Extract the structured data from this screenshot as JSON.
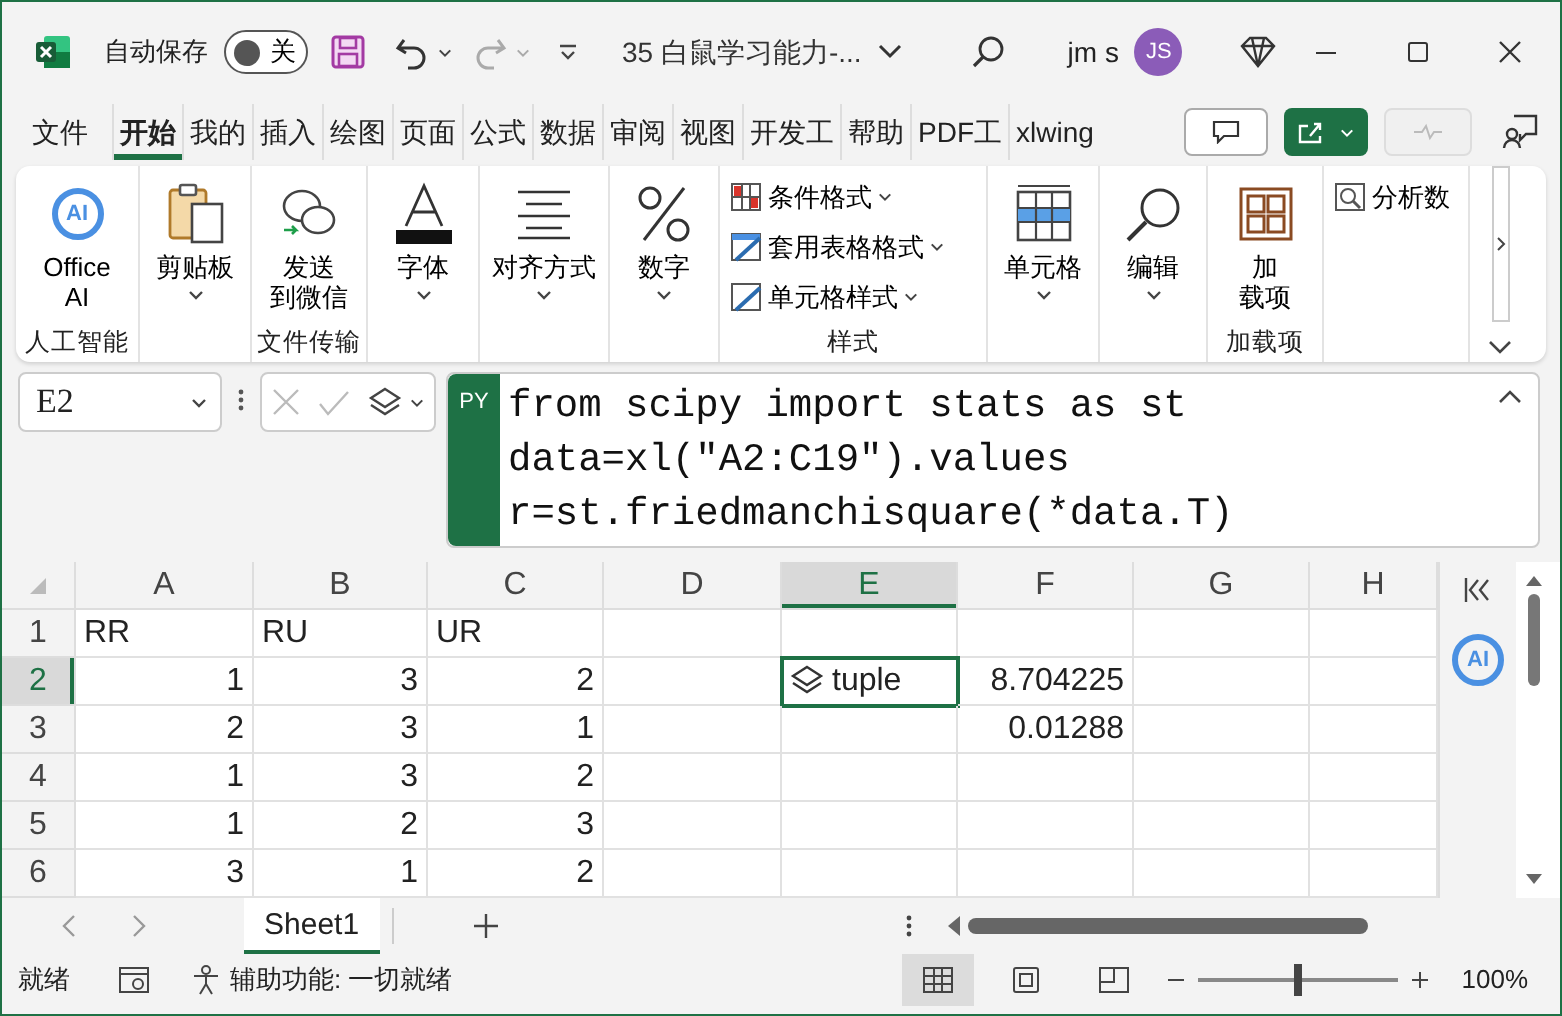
{
  "title_bar": {
    "autosave": {
      "label": "自动保存",
      "state_text": "关",
      "on": false
    },
    "filename": "35 白鼠学习能力-...",
    "user": "jm s",
    "avatar": "JS"
  },
  "tabs": [
    {
      "label": "文件",
      "selected": false
    },
    {
      "label": "开始",
      "selected": true
    },
    {
      "label": "我的",
      "selected": false
    },
    {
      "label": "插入",
      "selected": false
    },
    {
      "label": "绘图",
      "selected": false
    },
    {
      "label": "页面",
      "selected": false
    },
    {
      "label": "公式",
      "selected": false
    },
    {
      "label": "数据",
      "selected": false
    },
    {
      "label": "审阅",
      "selected": false
    },
    {
      "label": "视图",
      "selected": false
    },
    {
      "label": "开发工",
      "selected": false
    },
    {
      "label": "帮助",
      "selected": false
    },
    {
      "label": "PDF工",
      "selected": false
    },
    {
      "label": "xlwing",
      "selected": false
    }
  ],
  "ribbon": {
    "groups": [
      {
        "label": "人工智能",
        "items": [
          {
            "lines": [
              "Office",
              "AI"
            ],
            "kind": "large",
            "dropdown": false,
            "logo_text": "AI"
          }
        ]
      },
      {
        "items": [
          {
            "lines": [
              "剪贴板"
            ],
            "kind": "large",
            "dropdown": true
          }
        ]
      },
      {
        "label": "文件传输",
        "items": [
          {
            "lines": [
              "发送",
              "到微信"
            ],
            "kind": "large",
            "dropdown": false
          }
        ]
      },
      {
        "items": [
          {
            "lines": [
              "字体"
            ],
            "kind": "large",
            "dropdown": true
          }
        ]
      },
      {
        "items": [
          {
            "lines": [
              "对齐方式"
            ],
            "kind": "large",
            "dropdown": true
          }
        ]
      },
      {
        "items": [
          {
            "lines": [
              "数字"
            ],
            "kind": "large",
            "dropdown": true
          }
        ]
      },
      {
        "label": "样式",
        "items": [
          {
            "lines": [
              "条件格式"
            ],
            "kind": "small",
            "dropdown": true
          },
          {
            "lines": [
              "套用表格格式"
            ],
            "kind": "small",
            "dropdown": true
          },
          {
            "lines": [
              "单元格样式"
            ],
            "kind": "small",
            "dropdown": true
          }
        ]
      },
      {
        "items": [
          {
            "lines": [
              "单元格"
            ],
            "kind": "large",
            "dropdown": true
          }
        ]
      },
      {
        "items": [
          {
            "lines": [
              "编辑"
            ],
            "kind": "large",
            "dropdown": true
          }
        ]
      },
      {
        "label": "加载项",
        "items": [
          {
            "lines": [
              "加",
              "载项"
            ],
            "kind": "large",
            "dropdown": false
          }
        ]
      },
      {
        "items": [
          {
            "lines": [
              "分析数"
            ],
            "kind": "small",
            "dropdown": false
          }
        ]
      }
    ]
  },
  "formula_bar": {
    "name_box": "E2",
    "badge": "PY",
    "lines": [
      "from scipy import stats as st",
      "data=xl(\"A2:C19\").values",
      "r=st.friedmanchisquare(*data.T)"
    ]
  },
  "sheet": {
    "columns": [
      "A",
      "B",
      "C",
      "D",
      "E",
      "F",
      "G",
      "H"
    ],
    "rows": [
      {
        "number": "1",
        "cells": [
          {
            "text": "RR",
            "kind": "text",
            "selected": false
          },
          {
            "text": "RU",
            "kind": "text",
            "selected": false
          },
          {
            "text": "UR",
            "kind": "text",
            "selected": false
          }
        ]
      },
      {
        "number": "2",
        "cells": [
          {
            "text": "1",
            "kind": "number",
            "selected": false
          },
          {
            "text": "3",
            "kind": "number",
            "selected": false
          },
          {
            "text": "2",
            "kind": "number",
            "selected": false
          },
          {
            "text": "",
            "kind": "text",
            "selected": false
          },
          {
            "text": "tuple",
            "kind": "py_object",
            "selected": true
          },
          {
            "text": "8.704225",
            "kind": "number",
            "selected": false
          }
        ]
      },
      {
        "number": "3",
        "cells": [
          {
            "text": "2",
            "kind": "number",
            "selected": false
          },
          {
            "text": "3",
            "kind": "number",
            "selected": false
          },
          {
            "text": "1",
            "kind": "number",
            "selected": false
          },
          {
            "text": "",
            "kind": "text",
            "selected": false
          },
          {
            "text": "",
            "kind": "text",
            "selected": false
          },
          {
            "text": "0.01288",
            "kind": "number",
            "selected": false
          }
        ]
      },
      {
        "number": "4",
        "cells": [
          {
            "text": "1",
            "kind": "number",
            "selected": false
          },
          {
            "text": "3",
            "kind": "number",
            "selected": false
          },
          {
            "text": "2",
            "kind": "number",
            "selected": false
          }
        ]
      },
      {
        "number": "5",
        "cells": [
          {
            "text": "1",
            "kind": "number",
            "selected": false
          },
          {
            "text": "2",
            "kind": "number",
            "selected": false
          },
          {
            "text": "3",
            "kind": "number",
            "selected": false
          }
        ]
      },
      {
        "number": "6",
        "cells": [
          {
            "text": "3",
            "kind": "number",
            "selected": false
          },
          {
            "text": "1",
            "kind": "number",
            "selected": false
          },
          {
            "text": "2",
            "kind": "number",
            "selected": false
          }
        ]
      }
    ],
    "side_pane": {
      "logo_text": "AI"
    }
  },
  "sheet_tabs": [
    {
      "label": "Sheet1",
      "selected": true
    }
  ],
  "status_bar": {
    "ready": "就绪",
    "accessibility": "辅助功能: 一切就绪",
    "views": [
      {
        "selected": true
      },
      {
        "selected": false
      },
      {
        "selected": false
      }
    ],
    "zoom": {
      "level": 0.5,
      "text": "100%"
    }
  }
}
